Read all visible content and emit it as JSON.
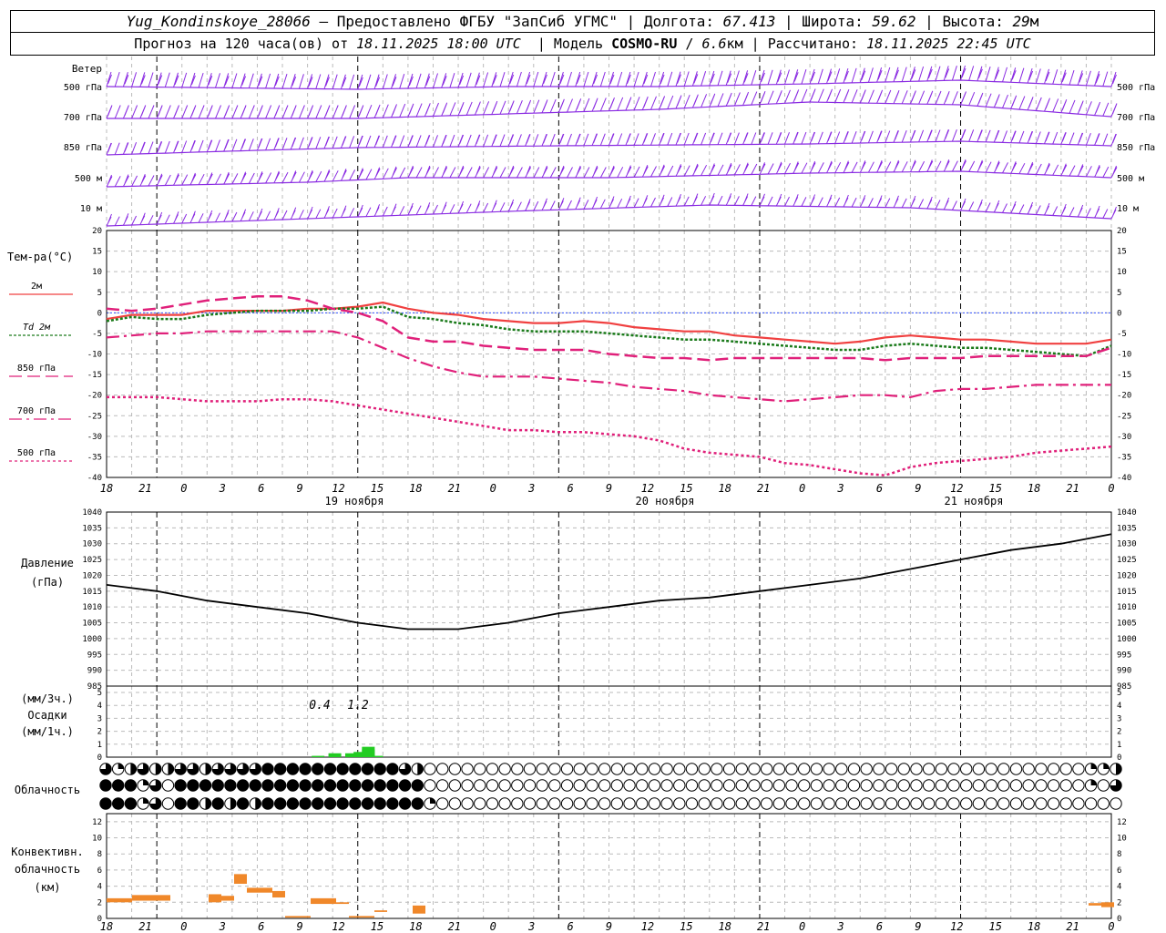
{
  "header": {
    "station": "Yug_Kondinskoye_28066",
    "provided": " – Предоставлено ФГБУ \"ЗапСиб УГМС\" | Долгота: ",
    "lon": "67.413",
    "lat_label": " | Широта: ",
    "lat": "59.62",
    "alt_label": " | Высота: ",
    "alt": "29",
    "alt_unit": "м",
    "line2_a": "Прогноз на 120 часа(ов) от ",
    "run_time": "18.11.2025 18:00 UTC",
    "line2_b": "  | Модель ",
    "model": "COSMO-RU",
    "line2_c": " / ",
    "res": "6.6",
    "line2_d": "км | Рассчитано: ",
    "calc_time": "18.11.2025 22:45 UTC"
  },
  "wind_panel": {
    "title": "Ветер",
    "levels": [
      "500 гПа",
      "700 гПа",
      "850 гПа",
      "500 м",
      "10  м"
    ],
    "color": "#8a2be2"
  },
  "time_axis": {
    "tick_labels": [
      "18",
      "21",
      "0",
      "3",
      "6",
      "9",
      "12",
      "15",
      "18",
      "21",
      "0",
      "3",
      "6",
      "9",
      "12",
      "15",
      "18",
      "21",
      "0",
      "3",
      "6",
      "9",
      "12",
      "15",
      "18",
      "21",
      "0"
    ],
    "day_labels": [
      "19 ноября",
      "20 ноября",
      "21 ноября"
    ]
  },
  "chart_data": [
    {
      "type": "line",
      "title": "Тем-ра(°C)",
      "ylim": [
        -40,
        20
      ],
      "yticks": [
        20,
        15,
        10,
        5,
        0,
        -5,
        -10,
        -15,
        -20,
        -25,
        -30,
        -35,
        -40
      ],
      "x_hours": [
        0,
        3,
        6,
        9,
        12,
        15,
        18,
        21,
        24,
        27,
        30,
        33,
        36,
        39,
        42,
        45,
        48,
        51,
        54,
        57,
        60,
        63,
        66,
        69,
        72,
        75,
        78,
        81,
        84,
        87,
        90,
        93,
        96,
        99,
        102,
        105,
        108,
        111,
        114,
        117,
        120
      ],
      "series": [
        {
          "name": "2м",
          "color": "#f04040",
          "values": [
            -1.5,
            -0.5,
            -0.5,
            -0.5,
            0.5,
            0.5,
            0.5,
            0.5,
            1,
            1,
            1.5,
            2.5,
            1,
            0,
            -0.5,
            -1.5,
            -2,
            -2.5,
            -2.5,
            -2,
            -2.5,
            -3.5,
            -4,
            -4.5,
            -4.5,
            -5.5,
            -6,
            -6.5,
            -7,
            -7.5,
            -7,
            -6,
            -5.5,
            -6,
            -6.5,
            -6.5,
            -7,
            -7.5,
            -7.5,
            -7.5,
            -6.5
          ]
        },
        {
          "name": "Td 2м",
          "color": "#1a7a1a",
          "values": [
            -2,
            -1,
            -1.5,
            -1.5,
            -0.5,
            0,
            0.5,
            0.5,
            0.5,
            1,
            1,
            1.5,
            -1,
            -1.5,
            -2.5,
            -3,
            -4,
            -4.5,
            -4.5,
            -4.5,
            -5,
            -5.5,
            -6,
            -6.5,
            -6.5,
            -7,
            -7.5,
            -8,
            -8.5,
            -9,
            -9,
            -8,
            -7.5,
            -8,
            -8.5,
            -8.5,
            -9,
            -9.5,
            -10,
            -10.5,
            -8
          ]
        },
        {
          "name": "850 гПа",
          "color": "#e0207a",
          "values": [
            1,
            0.5,
            1,
            2,
            3,
            3.5,
            4,
            4,
            3,
            1,
            0,
            -2,
            -6,
            -7,
            -7,
            -8,
            -8.5,
            -9,
            -9,
            -9,
            -10,
            -10.5,
            -11,
            -11,
            -11.5,
            -11,
            -11,
            -11,
            -11,
            -11,
            -11,
            -11.5,
            -11,
            -11,
            -11,
            -10.5,
            -10.5,
            -10.5,
            -10.5,
            -10.5,
            -8.5
          ]
        },
        {
          "name": "700 гПа",
          "color": "#e0207a",
          "values": [
            -6,
            -5.5,
            -5,
            -5,
            -4.5,
            -4.5,
            -4.5,
            -4.5,
            -4.5,
            -4.5,
            -6,
            -8.5,
            -11,
            -13,
            -14.5,
            -15.5,
            -15.5,
            -15.5,
            -16,
            -16.5,
            -17,
            -18,
            -18.5,
            -19,
            -20,
            -20.5,
            -21,
            -21.5,
            -21,
            -20.5,
            -20,
            -20,
            -20.5,
            -19,
            -18.5,
            -18.5,
            -18,
            -17.5,
            -17.5,
            -17.5,
            -17.5
          ]
        },
        {
          "name": "500 гПа",
          "color": "#e0207a",
          "values": [
            -20.5,
            -20.5,
            -20.5,
            -21,
            -21.5,
            -21.5,
            -21.5,
            -21,
            -21,
            -21.5,
            -22.5,
            -23.5,
            -24.5,
            -25.5,
            -26.5,
            -27.5,
            -28.5,
            -28.5,
            -29,
            -29,
            -29.5,
            -30,
            -31,
            -33,
            -34,
            -34.5,
            -35,
            -36.5,
            -37,
            -38,
            -39,
            -39.5,
            -37.5,
            -36.5,
            -36,
            -35.5,
            -35,
            -34,
            -33.5,
            -33,
            -32.5
          ]
        }
      ],
      "legend": [
        "2м",
        "Td  2м",
        "850 гПа",
        "700 гПа",
        "500 гПа"
      ]
    },
    {
      "type": "line",
      "title": "Давление",
      "ylabel": "(гПа)",
      "ylim": [
        985,
        1040
      ],
      "yticks": [
        1040,
        1035,
        1030,
        1025,
        1020,
        1015,
        1010,
        1005,
        1000,
        995,
        990,
        985
      ],
      "x_hours": [
        0,
        6,
        12,
        18,
        24,
        30,
        36,
        42,
        48,
        54,
        60,
        66,
        72,
        78,
        84,
        90,
        96,
        102,
        108,
        114,
        120
      ],
      "series": [
        {
          "name": "",
          "color": "#000000",
          "values": [
            1017,
            1015,
            1012,
            1010,
            1008,
            1005,
            1003,
            1003,
            1005,
            1008,
            1010,
            1012,
            1013,
            1015,
            1017,
            1019,
            1022,
            1025,
            1028,
            1030,
            1033
          ]
        }
      ]
    },
    {
      "type": "bar",
      "title": "Осадки",
      "ylabel_top": "(мм/3ч.)",
      "ylabel_bottom": "(мм/1ч.)",
      "ylim": [
        0,
        5
      ],
      "yticks": [
        5,
        4,
        3,
        2,
        1,
        0
      ],
      "color": "#22cc22",
      "bars": [
        {
          "start": 15,
          "end": 17,
          "value": 0.1
        },
        {
          "start": 17,
          "end": 19,
          "value": 0.3
        },
        {
          "start": 19,
          "end": 20,
          "value": 0.3
        },
        {
          "start": 20,
          "end": 21,
          "value": 0.4
        },
        {
          "start": 21,
          "end": 21,
          "value": 0.6
        },
        {
          "start": 21,
          "end": 22,
          "value": 0.8
        },
        {
          "start": 22,
          "end": 23,
          "value": 0.1
        }
      ],
      "annotations": [
        "0.4",
        "1.2"
      ]
    },
    {
      "type": "bar",
      "title": "Конвективн. облачность",
      "ylabel": "(км)",
      "ylim": [
        0,
        13
      ],
      "yticks": [
        12,
        10,
        8,
        6,
        4,
        2,
        0
      ],
      "color": "#f0882a",
      "bars": [
        {
          "start": 0,
          "end": 2,
          "bottom": 2.0,
          "top": 2.5
        },
        {
          "start": 2,
          "end": 5,
          "bottom": 2.2,
          "top": 2.9
        },
        {
          "start": 8,
          "end": 9,
          "bottom": 2.0,
          "top": 3.0
        },
        {
          "start": 9,
          "end": 10,
          "bottom": 2.2,
          "top": 2.8
        },
        {
          "start": 10,
          "end": 11,
          "bottom": 4.3,
          "top": 5.5
        },
        {
          "start": 11,
          "end": 13,
          "bottom": 3.2,
          "top": 3.8
        },
        {
          "start": 13,
          "end": 14,
          "bottom": 2.6,
          "top": 3.4
        },
        {
          "start": 14,
          "end": 16,
          "bottom": 0.1,
          "top": 0.3
        },
        {
          "start": 16,
          "end": 18,
          "bottom": 1.8,
          "top": 2.5
        },
        {
          "start": 18,
          "end": 19,
          "bottom": 1.8,
          "top": 2.0
        },
        {
          "start": 19,
          "end": 21,
          "bottom": 0.1,
          "top": 0.3
        },
        {
          "start": 21,
          "end": 22,
          "bottom": 0.8,
          "top": 1.0
        },
        {
          "start": 24,
          "end": 25,
          "bottom": 0.6,
          "top": 1.6
        },
        {
          "start": 77,
          "end": 78,
          "bottom": 1.6,
          "top": 1.9
        },
        {
          "start": 78,
          "end": 79,
          "bottom": 1.4,
          "top": 2.0
        }
      ]
    }
  ],
  "cloud_panel": {
    "title": "Облачность",
    "rows": [
      [
        6,
        2,
        4,
        6,
        4,
        4,
        6,
        6,
        4,
        6,
        6,
        6,
        6,
        8,
        8,
        8,
        8,
        8,
        8,
        8,
        8,
        8,
        8,
        8,
        6,
        4,
        0,
        0,
        0,
        0,
        0,
        0,
        0,
        0,
        0,
        0,
        0,
        0,
        0,
        0,
        0,
        0,
        0,
        0,
        0,
        0,
        0,
        0,
        0,
        0,
        0,
        0,
        0,
        0,
        0,
        0,
        0,
        0,
        0,
        0,
        0,
        0,
        0,
        0,
        0,
        0,
        0,
        0,
        0,
        0,
        0,
        0,
        0,
        0,
        0,
        0,
        0,
        0,
        0,
        2,
        2,
        4,
        6,
        4
      ],
      [
        8,
        8,
        8,
        2,
        6,
        0,
        8,
        8,
        8,
        8,
        8,
        8,
        8,
        8,
        8,
        8,
        8,
        8,
        8,
        8,
        8,
        8,
        8,
        8,
        8,
        8,
        0,
        0,
        0,
        0,
        0,
        0,
        0,
        0,
        0,
        0,
        0,
        0,
        0,
        0,
        0,
        0,
        0,
        0,
        0,
        0,
        0,
        0,
        0,
        0,
        0,
        0,
        0,
        0,
        0,
        0,
        0,
        0,
        0,
        0,
        0,
        0,
        0,
        0,
        0,
        0,
        0,
        0,
        0,
        0,
        0,
        0,
        0,
        0,
        0,
        0,
        0,
        0,
        0,
        2,
        0,
        6,
        8,
        8
      ],
      [
        8,
        8,
        8,
        2,
        6,
        0,
        8,
        8,
        4,
        8,
        4,
        8,
        4,
        8,
        8,
        8,
        8,
        8,
        8,
        8,
        8,
        8,
        8,
        8,
        8,
        8,
        2,
        0,
        0,
        0,
        0,
        0,
        0,
        0,
        0,
        0,
        0,
        0,
        0,
        0,
        0,
        0,
        0,
        0,
        0,
        0,
        0,
        0,
        0,
        0,
        0,
        0,
        0,
        0,
        0,
        0,
        0,
        0,
        0,
        0,
        0,
        0,
        0,
        0,
        0,
        0,
        0,
        0,
        0,
        0,
        0,
        0,
        0,
        0,
        0,
        0,
        0,
        0,
        0,
        0,
        0,
        0,
        8,
        2
      ]
    ]
  }
}
